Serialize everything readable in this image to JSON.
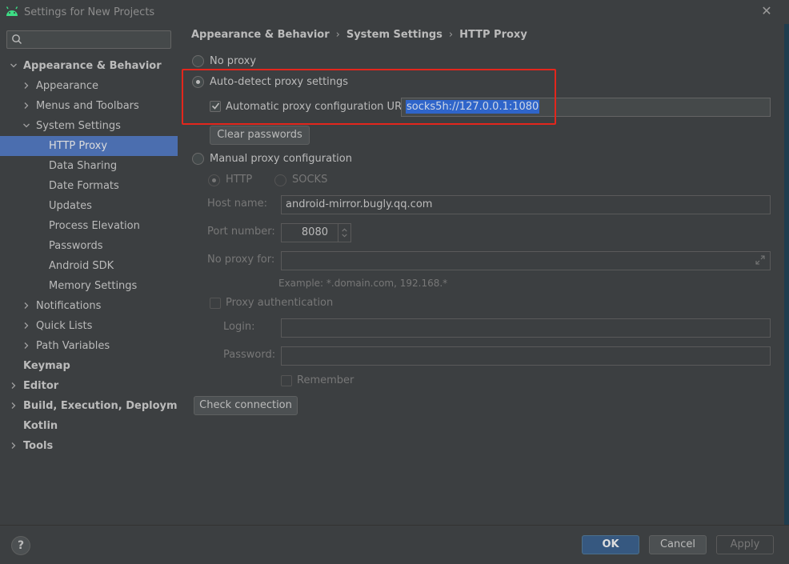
{
  "window": {
    "title": "Settings for New Projects",
    "close": "✕"
  },
  "search": {
    "placeholder": ""
  },
  "sidebar": {
    "items": [
      {
        "label": "Appearance & Behavior"
      },
      {
        "label": "Appearance"
      },
      {
        "label": "Menus and Toolbars"
      },
      {
        "label": "System Settings"
      },
      {
        "label": "HTTP Proxy"
      },
      {
        "label": "Data Sharing"
      },
      {
        "label": "Date Formats"
      },
      {
        "label": "Updates"
      },
      {
        "label": "Process Elevation"
      },
      {
        "label": "Passwords"
      },
      {
        "label": "Android SDK"
      },
      {
        "label": "Memory Settings"
      },
      {
        "label": "Notifications"
      },
      {
        "label": "Quick Lists"
      },
      {
        "label": "Path Variables"
      },
      {
        "label": "Keymap"
      },
      {
        "label": "Editor"
      },
      {
        "label": "Build, Execution, Deployment"
      },
      {
        "label": "Kotlin"
      },
      {
        "label": "Tools"
      }
    ]
  },
  "breadcrumb": {
    "items": [
      "Appearance & Behavior",
      "System Settings",
      "HTTP Proxy"
    ],
    "separator": "›"
  },
  "proxy": {
    "no_proxy_label": "No proxy",
    "auto_detect_label": "Auto-detect proxy settings",
    "auto_config_label": "Automatic proxy configuration URL:",
    "auto_config_url": "socks5h://127.0.0.1:1080",
    "clear_passwords_label": "Clear passwords",
    "manual_label": "Manual proxy configuration",
    "http_label": "HTTP",
    "socks_label": "SOCKS",
    "host_label": "Host name:",
    "host_value": "android-mirror.bugly.qq.com",
    "port_label": "Port number:",
    "port_value": "8080",
    "no_proxy_for_label": "No proxy for:",
    "no_proxy_for_value": "",
    "example_text": "Example: *.domain.com, 192.168.*",
    "proxy_auth_label": "Proxy authentication",
    "login_label": "Login:",
    "login_value": "",
    "password_label": "Password:",
    "password_value": "",
    "remember_label": "Remember",
    "check_connection_label": "Check connection"
  },
  "footer": {
    "help_label": "?",
    "ok_label": "OK",
    "cancel_label": "Cancel",
    "apply_label": "Apply"
  },
  "colors": {
    "background": "#3c3f41",
    "selection": "#4b6eaf",
    "highlight_box": "#e3261c",
    "text_selection": "#2f65ca",
    "ok_button": "#365880"
  }
}
